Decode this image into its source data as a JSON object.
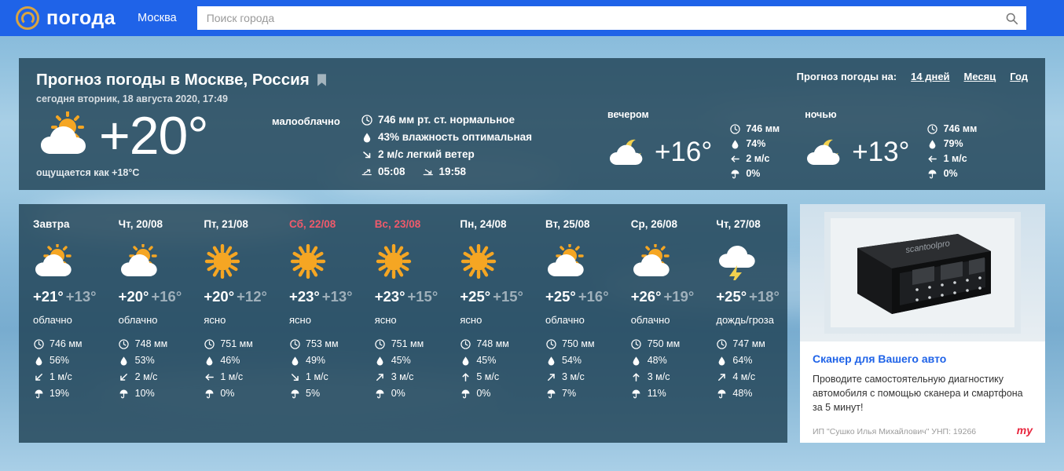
{
  "header": {
    "logo_text": "погода",
    "logo_icon": "at-circle-icon",
    "city": "Москва",
    "search_placeholder": "Поиск города",
    "search_value": "",
    "search_icon": "search-icon",
    "bar_color": "#1f63e8"
  },
  "current": {
    "title": "Прогноз погоды в Москве, Россия",
    "bookmark_icon": "bookmark-icon",
    "subtitle": "сегодня вторник, 18 августа 2020, 17:49",
    "forecast_for_label": "Прогноз погоды на:",
    "links": [
      {
        "label": "14 дней"
      },
      {
        "label": "Месяц"
      },
      {
        "label": "Год"
      }
    ],
    "icon": "sun-behind-cloud-icon",
    "temp": "+20°",
    "feels_like": "ощущается как +18°C",
    "condition": "малооблачно",
    "metrics": [
      {
        "icon": "pressure-icon",
        "text": "746 мм рт. ст. нормальное"
      },
      {
        "icon": "humidity-drop-icon",
        "text": "43% влажность оптимальная"
      },
      {
        "icon": "wind-arrow-down-right-icon",
        "text": "2 м/с легкий ветер"
      }
    ],
    "sunrise": {
      "icon": "sunrise-icon",
      "text": "05:08"
    },
    "sunset": {
      "icon": "sunset-icon",
      "text": "19:58"
    },
    "parts": [
      {
        "label": "вечером",
        "icon": "moon-behind-cloud-icon",
        "temp": "+16°",
        "metrics": [
          {
            "icon": "pressure-icon",
            "text": "746 мм"
          },
          {
            "icon": "humidity-drop-icon",
            "text": "74%"
          },
          {
            "icon": "wind-arrow-left-icon",
            "text": "2 м/с"
          },
          {
            "icon": "umbrella-icon",
            "text": "0%"
          }
        ]
      },
      {
        "label": "ночью",
        "icon": "moon-behind-cloud-icon",
        "temp": "+13°",
        "metrics": [
          {
            "icon": "pressure-icon",
            "text": "746 мм"
          },
          {
            "icon": "humidity-drop-icon",
            "text": "79%"
          },
          {
            "icon": "wind-arrow-left-icon",
            "text": "1 м/с"
          },
          {
            "icon": "umbrella-icon",
            "text": "0%"
          }
        ]
      }
    ]
  },
  "forecast_days": [
    {
      "name": "Завтра",
      "weekend": false,
      "icon": "sun-behind-cloud-icon",
      "day_temp": "+21°",
      "night_temp": "+13°",
      "condition": "облачно",
      "metrics": [
        {
          "icon": "pressure-icon",
          "text": "746 мм"
        },
        {
          "icon": "humidity-drop-icon",
          "text": "56%"
        },
        {
          "icon": "wind-arrow-down-left-icon",
          "text": "1 м/с"
        },
        {
          "icon": "umbrella-icon",
          "text": "19%"
        }
      ]
    },
    {
      "name": "Чт, 20/08",
      "weekend": false,
      "icon": "sun-behind-cloud-icon",
      "day_temp": "+20°",
      "night_temp": "+16°",
      "condition": "облачно",
      "metrics": [
        {
          "icon": "pressure-icon",
          "text": "748 мм"
        },
        {
          "icon": "humidity-drop-icon",
          "text": "53%"
        },
        {
          "icon": "wind-arrow-down-left-icon",
          "text": "2 м/с"
        },
        {
          "icon": "umbrella-icon",
          "text": "10%"
        }
      ]
    },
    {
      "name": "Пт, 21/08",
      "weekend": false,
      "icon": "sun-icon",
      "day_temp": "+20°",
      "night_temp": "+12°",
      "condition": "ясно",
      "metrics": [
        {
          "icon": "pressure-icon",
          "text": "751 мм"
        },
        {
          "icon": "humidity-drop-icon",
          "text": "46%"
        },
        {
          "icon": "wind-arrow-left-icon",
          "text": "1 м/с"
        },
        {
          "icon": "umbrella-icon",
          "text": "0%"
        }
      ]
    },
    {
      "name": "Сб, 22/08",
      "weekend": true,
      "icon": "sun-icon",
      "day_temp": "+23°",
      "night_temp": "+13°",
      "condition": "ясно",
      "metrics": [
        {
          "icon": "pressure-icon",
          "text": "753 мм"
        },
        {
          "icon": "humidity-drop-icon",
          "text": "49%"
        },
        {
          "icon": "wind-arrow-down-right-icon",
          "text": "1 м/с"
        },
        {
          "icon": "umbrella-icon",
          "text": "5%"
        }
      ]
    },
    {
      "name": "Вс, 23/08",
      "weekend": true,
      "icon": "sun-icon",
      "day_temp": "+23°",
      "night_temp": "+15°",
      "condition": "ясно",
      "metrics": [
        {
          "icon": "pressure-icon",
          "text": "751 мм"
        },
        {
          "icon": "humidity-drop-icon",
          "text": "45%"
        },
        {
          "icon": "wind-arrow-up-right-icon",
          "text": "3 м/с"
        },
        {
          "icon": "umbrella-icon",
          "text": "0%"
        }
      ]
    },
    {
      "name": "Пн, 24/08",
      "weekend": false,
      "icon": "sun-icon",
      "day_temp": "+25°",
      "night_temp": "+15°",
      "condition": "ясно",
      "metrics": [
        {
          "icon": "pressure-icon",
          "text": "748 мм"
        },
        {
          "icon": "humidity-drop-icon",
          "text": "45%"
        },
        {
          "icon": "wind-arrow-up-icon",
          "text": "5 м/с"
        },
        {
          "icon": "umbrella-icon",
          "text": "0%"
        }
      ]
    },
    {
      "name": "Вт, 25/08",
      "weekend": false,
      "icon": "sun-behind-cloud-icon",
      "day_temp": "+25°",
      "night_temp": "+16°",
      "condition": "облачно",
      "metrics": [
        {
          "icon": "pressure-icon",
          "text": "750 мм"
        },
        {
          "icon": "humidity-drop-icon",
          "text": "54%"
        },
        {
          "icon": "wind-arrow-up-right-icon",
          "text": "3 м/с"
        },
        {
          "icon": "umbrella-icon",
          "text": "7%"
        }
      ]
    },
    {
      "name": "Ср, 26/08",
      "weekend": false,
      "icon": "sun-behind-cloud-icon",
      "day_temp": "+26°",
      "night_temp": "+19°",
      "condition": "облачно",
      "metrics": [
        {
          "icon": "pressure-icon",
          "text": "750 мм"
        },
        {
          "icon": "humidity-drop-icon",
          "text": "48%"
        },
        {
          "icon": "wind-arrow-up-icon",
          "text": "3 м/с"
        },
        {
          "icon": "umbrella-icon",
          "text": "11%"
        }
      ]
    },
    {
      "name": "Чт, 27/08",
      "weekend": false,
      "icon": "cloud-lightning-icon",
      "day_temp": "+25°",
      "night_temp": "+18°",
      "condition": "дождь/гроза",
      "metrics": [
        {
          "icon": "pressure-icon",
          "text": "747 мм"
        },
        {
          "icon": "humidity-drop-icon",
          "text": "64%"
        },
        {
          "icon": "wind-arrow-up-right-icon",
          "text": "4 м/с"
        },
        {
          "icon": "umbrella-icon",
          "text": "48%"
        }
      ]
    }
  ],
  "ad": {
    "image_alt": "obd-scanner-photo",
    "product_brand_on_device": "scantoolpro",
    "title": "Сканер для Вашего авто",
    "text": "Проводите самостоятельную диагностику автомобиля с помощью сканера и смартфона за 5 минут!",
    "legal": "ИП \"Сушко Илья Михайлович\" УНП: 19266",
    "brand": "my",
    "title_color": "#1f63e8"
  }
}
